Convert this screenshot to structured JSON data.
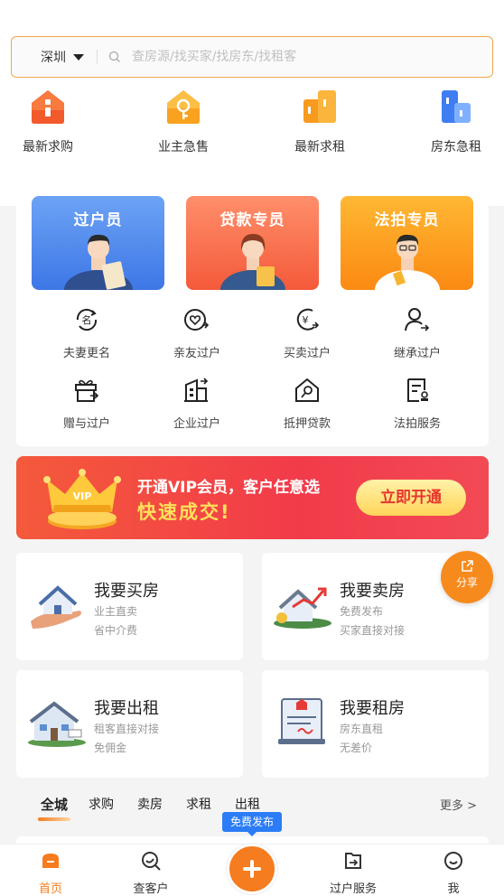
{
  "search": {
    "city": "深圳",
    "placeholder": "查房源/找买家/找房东/找租客"
  },
  "quick": [
    {
      "label": "最新求购",
      "icon": "house-red-icon"
    },
    {
      "label": "业主急售",
      "icon": "house-key-icon"
    },
    {
      "label": "最新求租",
      "icon": "buildings-orange-icon"
    },
    {
      "label": "房东急租",
      "icon": "buildings-blue-icon"
    }
  ],
  "agents": [
    {
      "title": "过户员"
    },
    {
      "title": "贷款专员"
    },
    {
      "title": "法拍专员"
    }
  ],
  "services": [
    {
      "label": "夫妻更名",
      "icon": "rename-icon"
    },
    {
      "label": "亲友过户",
      "icon": "heart-transfer-icon"
    },
    {
      "label": "买卖过户",
      "icon": "yuan-transfer-icon"
    },
    {
      "label": "继承过户",
      "icon": "person-transfer-icon"
    },
    {
      "label": "赠与过户",
      "icon": "gift-icon"
    },
    {
      "label": "企业过户",
      "icon": "enterprise-icon"
    },
    {
      "label": "抵押贷款",
      "icon": "house-mortgage-icon"
    },
    {
      "label": "法拍服务",
      "icon": "document-stamp-icon"
    }
  ],
  "vip": {
    "line1": "开通VIP会员，客户任意选",
    "line2": "快速成交!",
    "button": "立即开通",
    "crown_text": "VIP"
  },
  "tiles": [
    {
      "title": "我要买房",
      "sub1": "业主直卖",
      "sub2": "省中介费"
    },
    {
      "title": "我要卖房",
      "sub1": "免费发布",
      "sub2": "买家直接对接"
    },
    {
      "title": "我要出租",
      "sub1": "租客直接对接",
      "sub2": "免佣金"
    },
    {
      "title": "我要租房",
      "sub1": "房东直租",
      "sub2": "无差价"
    }
  ],
  "share": "分享",
  "filter": {
    "tabs": [
      "全城",
      "求购",
      "卖房",
      "求租",
      "出租"
    ],
    "more": "更多 >"
  },
  "publish_tip": "免费发布",
  "tabbar": [
    {
      "label": "首页",
      "icon": "home-icon",
      "active": true
    },
    {
      "label": "查客户",
      "icon": "search-client-icon"
    },
    {
      "label": "过户服务",
      "icon": "transfer-service-icon"
    },
    {
      "label": "我",
      "icon": "smile-icon"
    }
  ],
  "colors": {
    "accent": "#f57c1f",
    "vip_red": "#f23b4a",
    "publish_blue": "#2b7cf6"
  }
}
